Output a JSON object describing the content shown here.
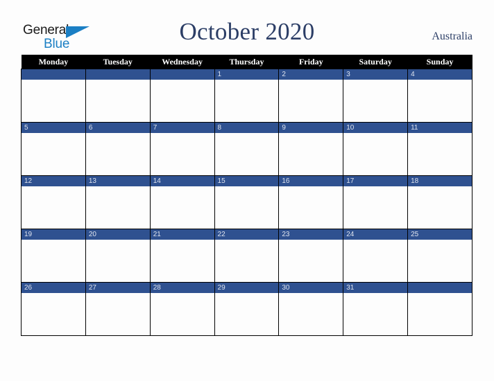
{
  "logo": {
    "word_one": "General",
    "word_two": "Blue",
    "triangle_icon": "triangle-icon",
    "color_dark": "#1a1a1a",
    "color_blue": "#1b7fc4"
  },
  "header": {
    "title": "October 2020",
    "country": "Australia",
    "title_color": "#2c3e66"
  },
  "calendar": {
    "weekday_headers": [
      "Monday",
      "Tuesday",
      "Wednesday",
      "Thursday",
      "Friday",
      "Saturday",
      "Sunday"
    ],
    "header_background": "#000000",
    "header_text_color": "#ffffff",
    "day_bar_color": "#2f5190",
    "day_number_color": "#dfe4ef",
    "cell_background": "#fdfdfd",
    "border_color": "#000000",
    "weeks": [
      {
        "days": [
          {
            "number": ""
          },
          {
            "number": ""
          },
          {
            "number": ""
          },
          {
            "number": "1"
          },
          {
            "number": "2"
          },
          {
            "number": "3"
          },
          {
            "number": "4"
          }
        ]
      },
      {
        "days": [
          {
            "number": "5"
          },
          {
            "number": "6"
          },
          {
            "number": "7"
          },
          {
            "number": "8"
          },
          {
            "number": "9"
          },
          {
            "number": "10"
          },
          {
            "number": "11"
          }
        ]
      },
      {
        "days": [
          {
            "number": "12"
          },
          {
            "number": "13"
          },
          {
            "number": "14"
          },
          {
            "number": "15"
          },
          {
            "number": "16"
          },
          {
            "number": "17"
          },
          {
            "number": "18"
          }
        ]
      },
      {
        "days": [
          {
            "number": "19"
          },
          {
            "number": "20"
          },
          {
            "number": "21"
          },
          {
            "number": "22"
          },
          {
            "number": "23"
          },
          {
            "number": "24"
          },
          {
            "number": "25"
          }
        ]
      },
      {
        "days": [
          {
            "number": "26"
          },
          {
            "number": "27"
          },
          {
            "number": "28"
          },
          {
            "number": "29"
          },
          {
            "number": "30"
          },
          {
            "number": "31"
          },
          {
            "number": ""
          }
        ]
      }
    ]
  }
}
